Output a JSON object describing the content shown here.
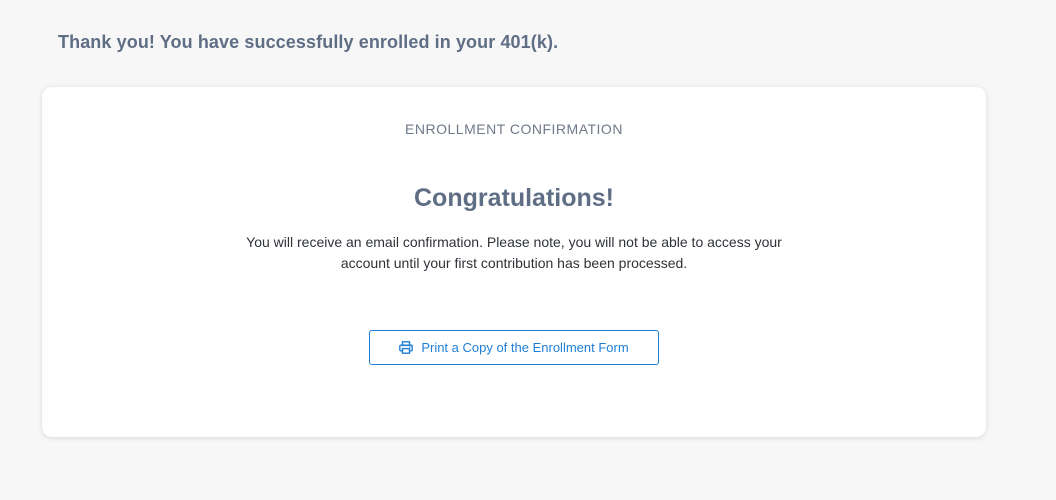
{
  "page": {
    "heading": "Thank you! You have successfully enrolled in your 401(k)."
  },
  "card": {
    "label": "ENROLLMENT CONFIRMATION",
    "title": "Congratulations!",
    "message": "You will receive an email confirmation. Please note, you will not be able to access your account until your first contribution has been processed.",
    "print_button": {
      "label": "Print a Copy of the Enrollment Form",
      "icon": "printer-icon"
    }
  },
  "colors": {
    "background": "#f7f7f7",
    "heading": "#5f6e85",
    "accent": "#1f7fd6",
    "body_text": "#2f3338"
  }
}
